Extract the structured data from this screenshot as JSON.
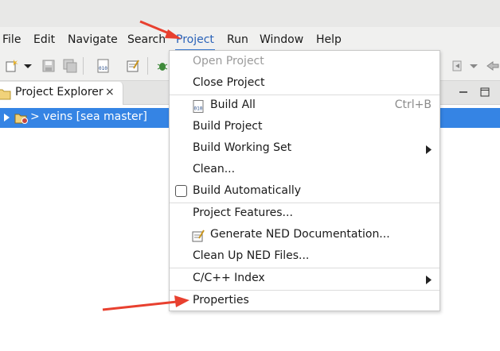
{
  "menubar": {
    "items": [
      {
        "label": "File"
      },
      {
        "label": "Edit"
      },
      {
        "label": "Navigate"
      },
      {
        "label": "Search"
      },
      {
        "label": "Project",
        "active": true
      },
      {
        "label": "Run"
      },
      {
        "label": "Window"
      },
      {
        "label": "Help"
      }
    ]
  },
  "explorer": {
    "tab_label": "Project Explorer",
    "close_glyph": "×"
  },
  "tree": {
    "selected_row_label": "> veins [sea master]",
    "selection_color": "#3584e4"
  },
  "project_menu": {
    "open_project": "Open Project",
    "close_project": "Close Project",
    "build_all": "Build All",
    "build_all_shortcut": "Ctrl+B",
    "build_project": "Build Project",
    "build_working_set": "Build Working Set",
    "clean": "Clean...",
    "build_automatically": "Build Automatically",
    "build_automatically_checked": false,
    "project_features": "Project Features...",
    "generate_ned_doc": "Generate NED Documentation...",
    "clean_up_ned": "Clean Up NED Files...",
    "cpp_index": "C/C++ Index",
    "properties": "Properties"
  },
  "annotation": {
    "arrow_color": "#e8402f"
  },
  "icons": {
    "new_wizard": "new-wizard-icon",
    "save": "save-icon",
    "save_all": "save-all-icon",
    "binary": "binary-icon",
    "ned_doc": "ned-doc-icon",
    "debug": "debug-icon",
    "folder": "folder-icon",
    "project": "project-icon",
    "minimize": "minimize-icon",
    "maximize": "maximize-icon",
    "submenu": "chevron-right-icon"
  }
}
